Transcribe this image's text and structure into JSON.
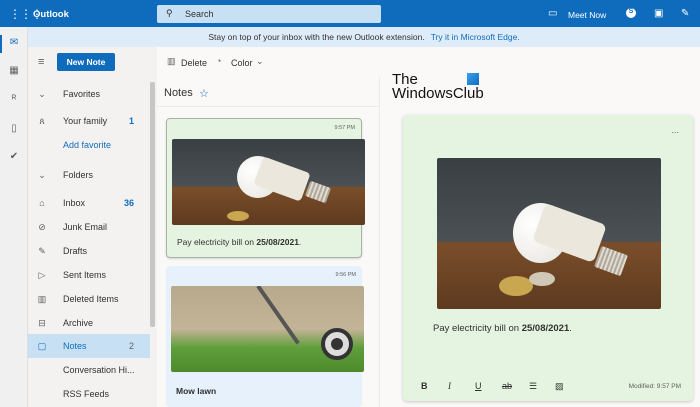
{
  "app": {
    "title": "Outlook"
  },
  "search": {
    "placeholder": "Search"
  },
  "header": {
    "meet_now": "Meet Now"
  },
  "banner": {
    "text": "Stay on top of your inbox with the new Outlook extension.",
    "link": "Try it in Microsoft Edge."
  },
  "sidebar": {
    "new_note": "New Note",
    "favorites": "Favorites",
    "your_family": "Your family",
    "your_family_count": "1",
    "add_favorite": "Add favorite",
    "folders": "Folders",
    "items": [
      {
        "label": "Inbox",
        "count": "36",
        "icon": "inbox-icon"
      },
      {
        "label": "Junk Email",
        "count": "",
        "icon": "block-icon"
      },
      {
        "label": "Drafts",
        "count": "",
        "icon": "pencil-icon"
      },
      {
        "label": "Sent Items",
        "count": "",
        "icon": "send-icon"
      },
      {
        "label": "Deleted Items",
        "count": "",
        "icon": "trash-icon"
      },
      {
        "label": "Archive",
        "count": "",
        "icon": "archive-icon"
      },
      {
        "label": "Notes",
        "count": "2",
        "icon": "note-icon"
      },
      {
        "label": "Conversation Hi...",
        "count": ""
      },
      {
        "label": "RSS Feeds",
        "count": ""
      }
    ]
  },
  "toolbar": {
    "delete": "Delete",
    "color": "Color"
  },
  "list": {
    "title": "Notes",
    "notes": [
      {
        "time": "9:57 PM",
        "text": "Pay electricity bill on ",
        "bold": "25/08/2021",
        "end": ".",
        "color": "#e4f4e1"
      },
      {
        "time": "9:56 PM",
        "bold": "Mow lawn",
        "color": "#e6f1fc"
      }
    ]
  },
  "watermark": {
    "line1": "The",
    "line2": "WindowsClub"
  },
  "detail": {
    "text": "Pay electricity bill on ",
    "bold": "25/08/2021",
    "end": ".",
    "more": "...",
    "modified": "Modified: 9:57 PM",
    "format": {
      "bold": "B",
      "italic": "I",
      "underline": "U",
      "strike": "ab"
    }
  }
}
